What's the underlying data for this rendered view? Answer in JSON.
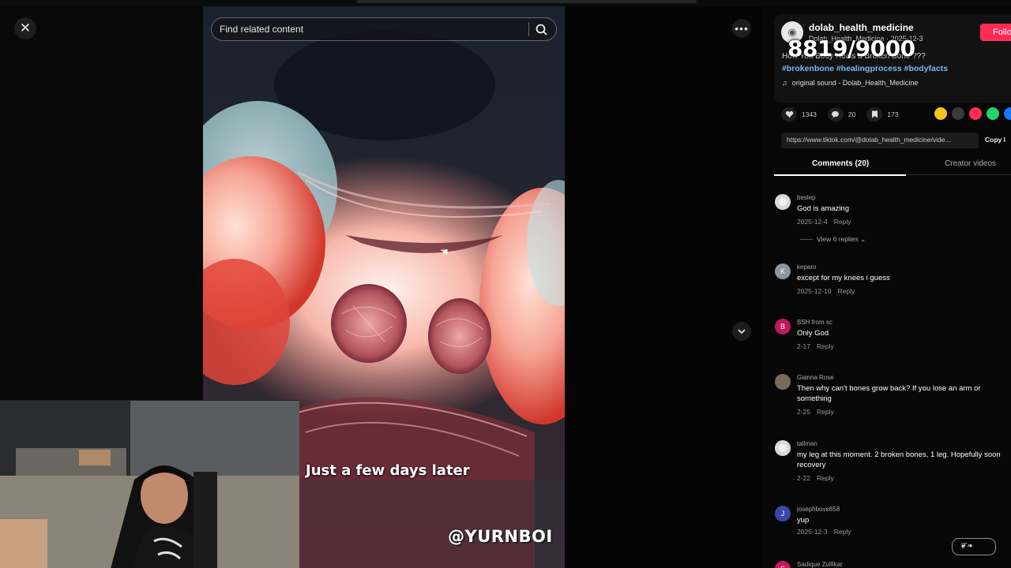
{
  "player": {
    "search_placeholder": "Find related content",
    "caption": "Just a few days later",
    "watermark": "@YURNBOI"
  },
  "overlay": {
    "counter": "8819/9000"
  },
  "post": {
    "username": "dolab_health_medicine",
    "nickname_date": "Dolab_Health_Medicine · 2025-12-3",
    "follow_label": "Follo",
    "description": "How You Body Heals a Broken Bone ???",
    "hashtags": "#brokenbone #healingprocess #bodyfacts",
    "sound": "original sound - Dolab_Health_Medicine",
    "likes": "1343",
    "comments": "20",
    "saves": "173",
    "link": "https://www.tiktok.com/@dolab_health_medicine/vide...",
    "copy_label": "Copy l",
    "share_colors": [
      "#f7c21b",
      "#3a3a3a",
      "#fe2c55",
      "#25d366",
      "#1877f2"
    ]
  },
  "tabs": {
    "comments_label": "Comments (20)",
    "creator_label": "Creator videos"
  },
  "comments": [
    {
      "user": "beslep",
      "text": "God is amazing",
      "date": "2025-12-4",
      "reply": "Reply",
      "initial": "",
      "color": "#d9d9d9",
      "view_replies": "View 6 replies"
    },
    {
      "user": "keparo",
      "text": "except for my knees i guess",
      "date": "2025-12-10",
      "reply": "Reply",
      "initial": "K",
      "color": "#8b969e"
    },
    {
      "user": "BSH from sc",
      "text": "Only God",
      "date": "2-17",
      "reply": "Reply",
      "initial": "B",
      "color": "#c2185b"
    },
    {
      "user": "Gianna Rose",
      "text": "Then why can't bones grow back? If you lose an arm or something",
      "date": "2-25",
      "reply": "Reply",
      "initial": "",
      "color": "#7a6a55"
    },
    {
      "user": "tallman",
      "text": "my leg at this moment. 2 broken bones, 1 leg. Hopefully soon recovery",
      "date": "2-22",
      "reply": "Reply",
      "initial": "",
      "color": "#d9d9d9"
    },
    {
      "user": "josephbove858",
      "text": "yup",
      "date": "2025-12-3",
      "reply": "Reply",
      "initial": "J",
      "color": "#3949ab"
    },
    {
      "user": "Sadique Zulfikar",
      "text": "",
      "date": "",
      "reply": "",
      "initial": "S",
      "color": "#c2185b"
    }
  ],
  "icons": {
    "close": "close-icon",
    "more": "more-icon",
    "down": "chevron-down-icon",
    "search": "search-icon"
  }
}
